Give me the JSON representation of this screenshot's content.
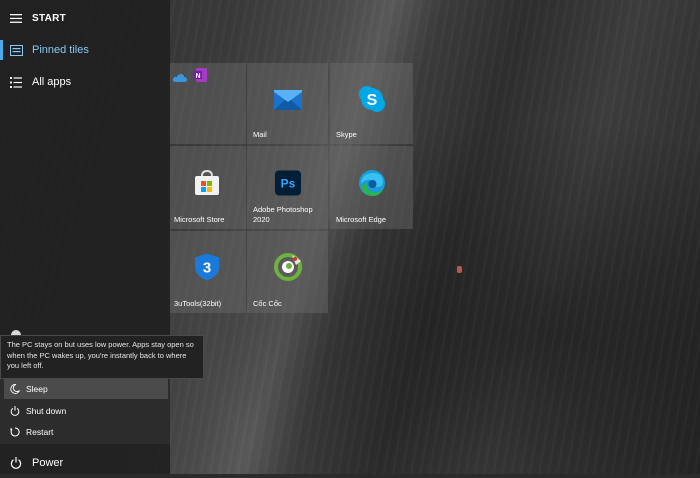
{
  "sidebar": {
    "title": "START",
    "pinned_tiles": "Pinned tiles",
    "all_apps": "All apps",
    "power": "Power"
  },
  "tooltip": {
    "text": "The PC stays on but uses low power. Apps stay open so when the PC wakes up, you're instantly back to where you left off."
  },
  "power_menu": {
    "sleep": "Sleep",
    "shut_down": "Shut down",
    "restart": "Restart"
  },
  "tiles": {
    "mail": "Mail",
    "skype": "Skype",
    "store": "Microsoft Store",
    "photoshop_line1": "Adobe Photoshop",
    "photoshop_line2": "2020",
    "edge": "Microsoft Edge",
    "utools": "3uTools(32bit)",
    "coccoc": "Cốc Cốc"
  },
  "colors": {
    "accent": "#4aa8e8",
    "mail": "#1a73c9",
    "skype": "#00a8e8",
    "photoshop": "#31a8ff",
    "edge": "#1a9ad6",
    "coccoc": "#6cb33e"
  }
}
